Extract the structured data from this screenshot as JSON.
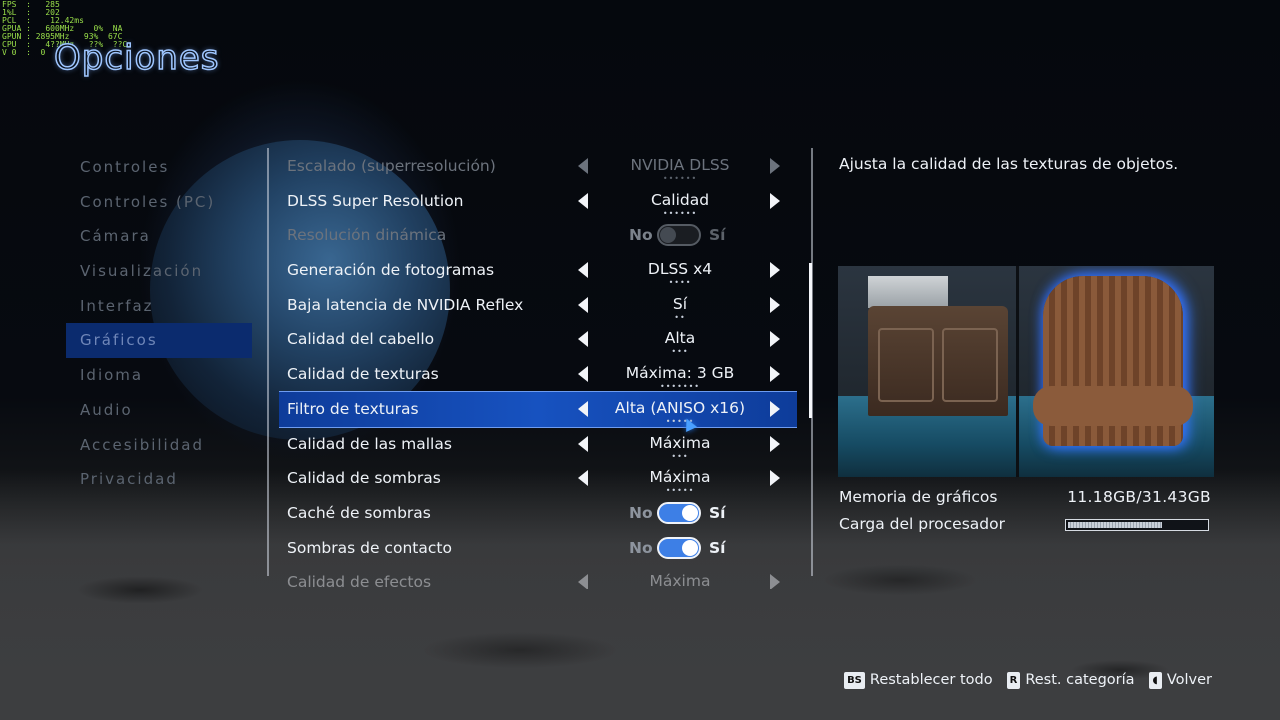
{
  "hud": {
    "lines": [
      "FPS  :   285",
      "1%L  :   202",
      "PCL  :    12.42ms",
      "GPUA :   600MHz    0%  NA",
      "GPUN : 2895MHz   93%  67C",
      "CPU  :   4??MHz   ??%  ??C",
      "V 0  :  0"
    ]
  },
  "title": "Opciones",
  "sidebar": {
    "items": [
      {
        "label": "Controles",
        "active": false
      },
      {
        "label": "Controles (PC)",
        "active": false
      },
      {
        "label": "Cámara",
        "active": false
      },
      {
        "label": "Visualización",
        "active": false
      },
      {
        "label": "Interfaz",
        "active": false
      },
      {
        "label": "Gráficos",
        "active": true
      },
      {
        "label": "Idioma",
        "active": false
      },
      {
        "label": "Audio",
        "active": false
      },
      {
        "label": "Accesibilidad",
        "active": false
      },
      {
        "label": "Privacidad",
        "active": false
      }
    ]
  },
  "settings": [
    {
      "label": "Escalado (superresolución)",
      "type": "select",
      "value": "NVIDIA DLSS",
      "dots": "••••••",
      "state": "dim"
    },
    {
      "label": "DLSS Super Resolution",
      "type": "select",
      "value": "Calidad",
      "dots": "••••••",
      "state": "normal"
    },
    {
      "label": "Resolución dinámica",
      "type": "toggle",
      "on": false,
      "no": "No",
      "si": "Sí",
      "state": "dim"
    },
    {
      "label": "Generación de fotogramas",
      "type": "select",
      "value": "DLSS x4",
      "dots": "••••",
      "state": "normal"
    },
    {
      "label": "Baja latencia de NVIDIA Reflex",
      "type": "select",
      "value": "Sí",
      "dots": "••",
      "state": "normal"
    },
    {
      "label": "Calidad del cabello",
      "type": "select",
      "value": "Alta",
      "dots": "•••",
      "state": "normal"
    },
    {
      "label": "Calidad de texturas",
      "type": "select",
      "value": "Máxima: 3 GB",
      "dots": "•••••••",
      "state": "normal"
    },
    {
      "label": "Filtro de texturas",
      "type": "select",
      "value": "Alta (ANISO x16)",
      "dots": "•••••",
      "state": "selected"
    },
    {
      "label": "Calidad de las mallas",
      "type": "select",
      "value": "Máxima",
      "dots": "•••",
      "state": "normal"
    },
    {
      "label": "Calidad de sombras",
      "type": "select",
      "value": "Máxima",
      "dots": "•••••",
      "state": "normal"
    },
    {
      "label": "Caché de sombras",
      "type": "toggle",
      "on": true,
      "no": "No",
      "si": "Sí",
      "state": "normal"
    },
    {
      "label": "Sombras de contacto",
      "type": "toggle",
      "on": true,
      "no": "No",
      "si": "Sí",
      "state": "normal"
    },
    {
      "label": "Calidad de efectos",
      "type": "select",
      "value": "Máxima",
      "dots": "",
      "state": "faded"
    }
  ],
  "detail": {
    "description": "Ajusta la calidad de las texturas de objetos.",
    "gpu_memory_label": "Memoria de gráficos",
    "gpu_memory_value": "11.18GB/31.43GB",
    "cpu_load_label": "Carga del procesador",
    "cpu_load_fraction": 0.67
  },
  "footer": {
    "reset_all_key": "BS",
    "reset_all_label": "Restablecer todo",
    "reset_cat_key": "R",
    "reset_cat_label": "Rest. categoría",
    "back_key": "◖",
    "back_label": "Volver"
  },
  "colors": {
    "accent": "#1752c0",
    "sidebar_active": "#0b2b6e",
    "toggle_on": "#3d7fe6"
  }
}
